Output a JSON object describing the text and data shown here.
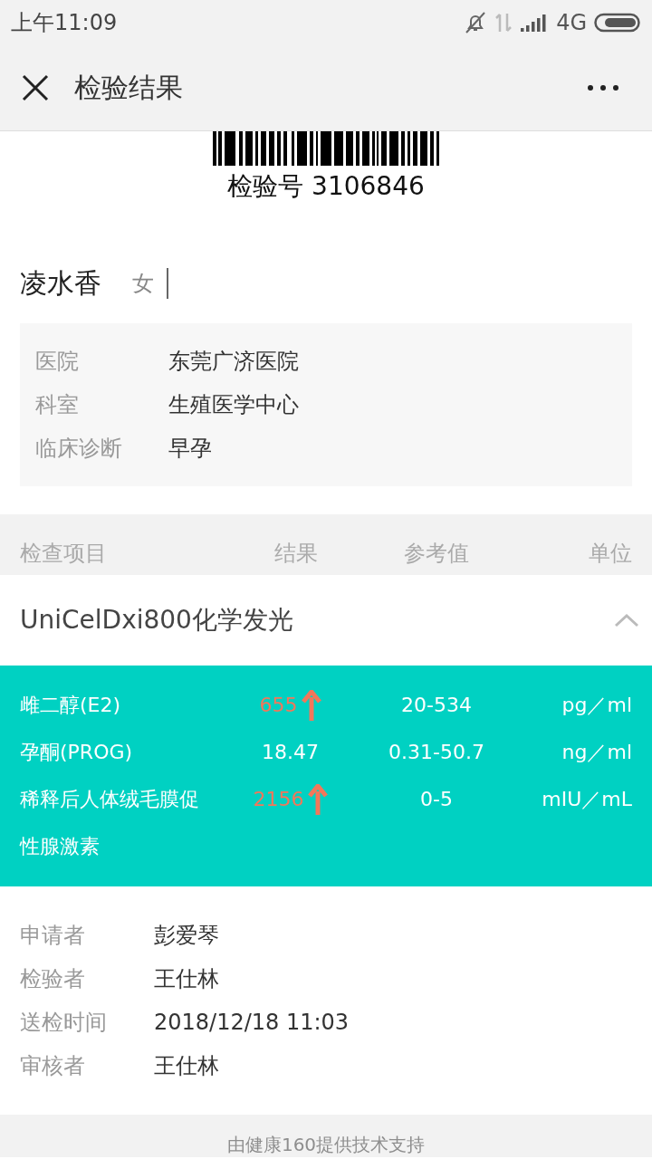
{
  "status_bar": {
    "time": "上午11:09",
    "network": "4G"
  },
  "nav": {
    "title": "检验结果"
  },
  "barcode": {
    "label": "检验号 3106846"
  },
  "patient": {
    "name": "凌水香",
    "sex": "女"
  },
  "info": [
    {
      "label": "医院",
      "value": "东莞广济医院"
    },
    {
      "label": "科室",
      "value": "生殖医学中心"
    },
    {
      "label": "临床诊断",
      "value": "早孕"
    }
  ],
  "table": {
    "columns": [
      "检查项目",
      "结果",
      "参考值",
      "单位"
    ],
    "group": {
      "title": "UniCelDxi800化学发光",
      "expanded": true,
      "rows": [
        {
          "item": "雌二醇(E2)",
          "result": "655",
          "high": true,
          "reference": "20-534",
          "unit": "pg／ml"
        },
        {
          "item": "孕酮(PROG)",
          "result": "18.47",
          "high": false,
          "reference": "0.31-50.7",
          "unit": "ng／ml"
        },
        {
          "item": "稀释后人体绒毛膜促性腺激素",
          "result": "2156",
          "high": true,
          "reference": "0-5",
          "unit": "mIU／mL"
        }
      ]
    }
  },
  "staff": [
    {
      "label": "申请者",
      "value": "彭爱琴"
    },
    {
      "label": "检验者",
      "value": "王仕林"
    },
    {
      "label": "送检时间",
      "value": "2018/12/18 11:03"
    },
    {
      "label": "审核者",
      "value": "王仕林"
    }
  ],
  "footer": {
    "text": "由健康160提供技术支持"
  }
}
